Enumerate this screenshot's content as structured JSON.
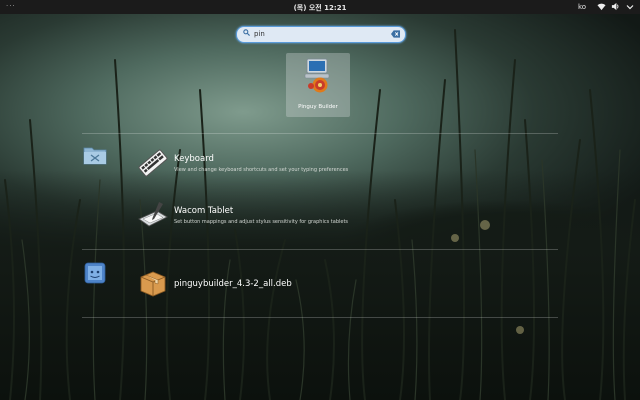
{
  "topbar": {
    "activities": "···",
    "clock": "(목) 오전 12:21",
    "language": "ko"
  },
  "search": {
    "value": "pin",
    "placeholder": ""
  },
  "app_results": [
    {
      "label": "Pinguy Builder",
      "icon": "pinguy-builder-icon"
    }
  ],
  "settings_results": [
    {
      "title": "Keyboard",
      "description": "View and change keyboard shortcuts and set your typing preferences",
      "icon": "keyboard-icon"
    },
    {
      "title": "Wacom Tablet",
      "description": "Set button mappings and adjust stylus sensitivity for graphics tablets",
      "icon": "wacom-tablet-icon"
    }
  ],
  "file_results": [
    {
      "title": "pinguybuilder_4.3-2_all.deb",
      "icon": "package-icon"
    }
  ],
  "colors": {
    "topbar": "#1b1b1b",
    "search_border": "#5a9bd9",
    "search_bg": "#dfe9f4"
  }
}
